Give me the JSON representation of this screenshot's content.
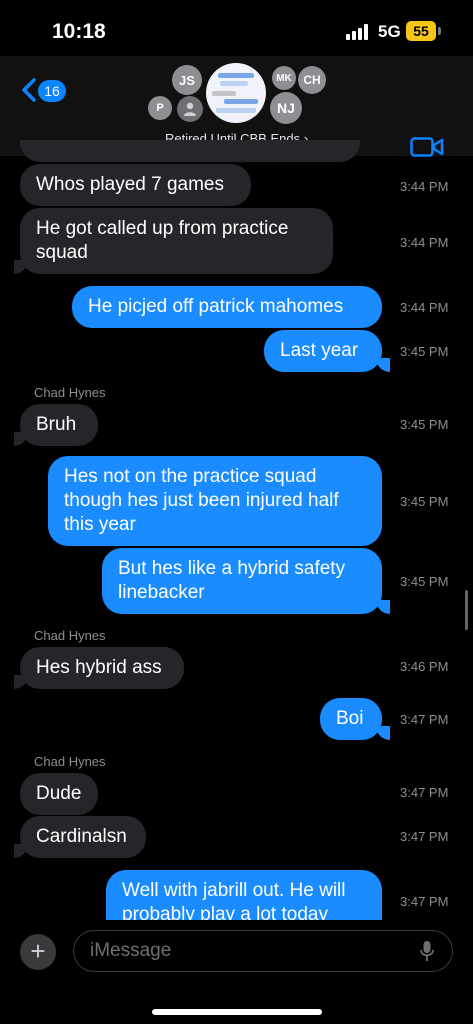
{
  "status": {
    "time": "10:18",
    "network": "5G",
    "battery": "55"
  },
  "header": {
    "back_count": "16",
    "group_name": "Retired Until CBB Ends ›",
    "avatars": [
      "JS",
      "P",
      "MK",
      "CH",
      "NJ"
    ]
  },
  "messages": [
    {
      "from": "in",
      "text": "Whos played 7 games",
      "time": "3:44 PM"
    },
    {
      "from": "in",
      "text": "He got called up from practice squad",
      "time": "3:44 PM"
    },
    {
      "from": "out",
      "text": "He picjed off patrick mahomes",
      "time": "3:44 PM"
    },
    {
      "from": "out",
      "text": "Last year",
      "time": "3:45 PM"
    },
    {
      "sender": "Chad Hynes"
    },
    {
      "from": "in",
      "text": "Bruh",
      "time": "3:45 PM"
    },
    {
      "from": "out",
      "text": "Hes not on the practice squad though hes just been injured half this year",
      "time": "3:45 PM"
    },
    {
      "from": "out",
      "text": "But hes like a hybrid safety linebacker",
      "time": "3:45 PM"
    },
    {
      "sender": "Chad Hynes"
    },
    {
      "from": "in",
      "text": "Hes hybrid ass",
      "time": "3:46 PM"
    },
    {
      "from": "out",
      "text": "Boi",
      "time": "3:47 PM"
    },
    {
      "sender": "Chad Hynes"
    },
    {
      "from": "in",
      "text": "Dude",
      "time": "3:47 PM"
    },
    {
      "from": "in",
      "text": "Cardinalsn",
      "time": "3:47 PM"
    },
    {
      "from": "out",
      "text": "Well with jabrill out. He will probably play a lot today",
      "time": "3:47 PM"
    }
  ],
  "composer": {
    "placeholder": "iMessage",
    "plus_label": "+"
  },
  "colors": {
    "accent": "#0a84ff",
    "outgoing": "#1a8cff",
    "incoming": "#26252a"
  }
}
